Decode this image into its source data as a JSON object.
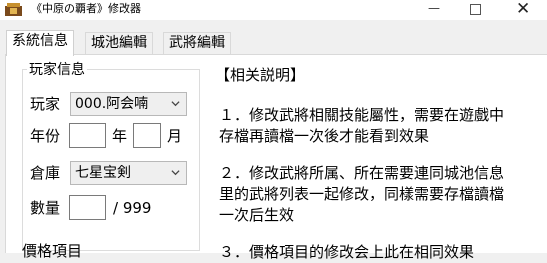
{
  "window": {
    "title": "《中原の覇者》修改器",
    "minimize": "—",
    "close": "✕"
  },
  "tabs": [
    "系統信息",
    "城池編輯",
    "武將編輯"
  ],
  "player_group": {
    "title": "玩家信息",
    "player_label": "玩家",
    "player_value": "000.阿会喃",
    "year_label": "年份",
    "year_unit": "年",
    "month_unit": "月",
    "warehouse_label": "倉庫",
    "warehouse_value": "七星宝剣",
    "quantity_label": "數量",
    "quantity_max": "/ 999"
  },
  "help": {
    "title": "【相关説明】",
    "para1_line1": "１．修改武將相關技能屬性，需要在遊戲中",
    "para1_line2": "存檔再讀檔一次後才能看到效果",
    "para2_line1": "２．修改武將所属、所在需要連同城池信息",
    "para2_line2": "里的武將列表一起修改，同樣需要存檔讀檔",
    "para2_line3": "一次后生效",
    "para3_partial": "３．價格項目的修改会上此在相同效果"
  },
  "partial_group_label": "價格項目"
}
